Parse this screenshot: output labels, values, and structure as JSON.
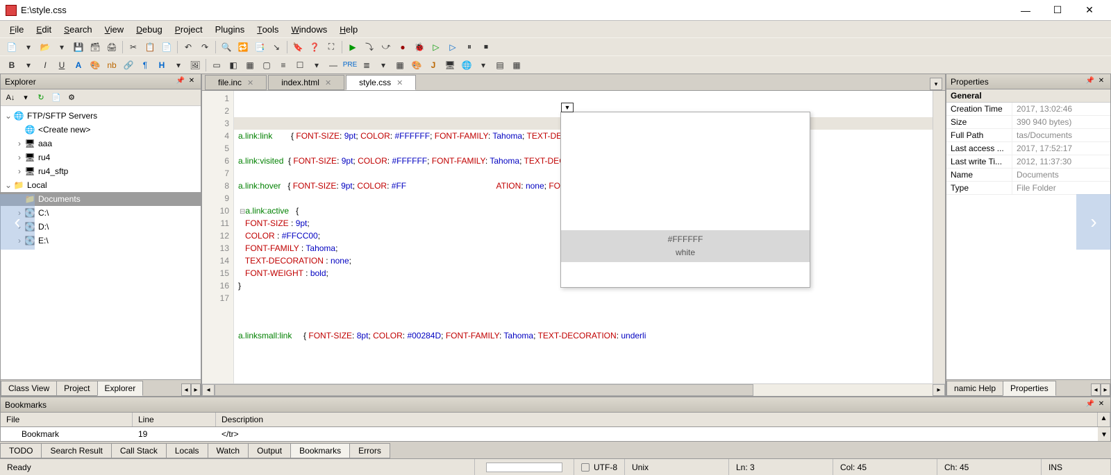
{
  "window": {
    "title": "E:\\style.css"
  },
  "menus": [
    "File",
    "Edit",
    "Search",
    "View",
    "Debug",
    "Project",
    "Plugins",
    "Tools",
    "Windows",
    "Help"
  ],
  "explorer": {
    "title": "Explorer",
    "root_label": "FTP/SFTP Servers",
    "create_new": "<Create new>",
    "items": [
      "aaa",
      "ru4",
      "ru4_sftp"
    ],
    "local_label": "Local",
    "documents": "Documents",
    "drives": [
      "C:\\",
      "D:\\",
      "E:\\"
    ],
    "bottom_tabs": [
      "Class View",
      "Project",
      "Explorer"
    ]
  },
  "file_tabs": [
    "file.inc",
    "index.html",
    "style.css"
  ],
  "active_tab": 2,
  "code_lines": [
    {
      "n": 1,
      "html": "<span class='id'>a.link:link</span>        { <span class='kw'>FONT-SIZE</span>: <span class='val'>9pt</span>; <span class='kw'>COLOR</span>: <span class='val'>#FFFFFF</span>; <span class='kw'>FONT-FAMILY</span>: <span class='val'>Tahoma</span>; <span class='kw'>TEXT-DECORATION</span>: <span class='val'>none</span>; <span class='kw'>F</span>"
    },
    {
      "n": 2,
      "html": ""
    },
    {
      "n": 3,
      "hl": true,
      "html": "<span class='id'>a.link:visited</span>  { <span class='kw'>FONT-SIZE</span>: <span class='val'>9pt</span>; <span class='kw'>COLOR</span>: <span class='val'>#FFFFFF</span>; <span class='kw'>FONT-FAMILY</span>: <span class='val'>Tahoma</span>; <span class='kw'>TEXT-DECORATION</span>: <span class='val'>none</span>; <span class='kw'>FONT-</span>"
    },
    {
      "n": 4,
      "html": ""
    },
    {
      "n": 5,
      "html": "<span class='id'>a.link:hover</span>   { <span class='kw'>FONT-SIZE</span>: <span class='val'>9pt</span>; <span class='kw'>COLOR</span>: <span class='val'>#FF</span>                                       <span class='kw' style='margin-left:0'>ATION</span>: <span class='val'>none</span>; <span class='kw'>FONT-</span>"
    },
    {
      "n": 6,
      "html": ""
    },
    {
      "n": 7,
      "html": "<span class='fold'>⊟</span><span class='id'>a.link:active</span>   {"
    },
    {
      "n": 8,
      "html": "   <span class='kw'>FONT-SIZE</span> : <span class='val'>9pt</span>;"
    },
    {
      "n": 9,
      "html": "   <span class='kw'>COLOR</span> : <span class='val'>#FFCC00</span>;"
    },
    {
      "n": 10,
      "html": "   <span class='kw'>FONT-FAMILY</span> : <span class='val'>Tahoma</span>;"
    },
    {
      "n": 11,
      "html": "   <span class='kw'>TEXT-DECORATION</span> : <span class='val'>none</span>;"
    },
    {
      "n": 12,
      "html": "   <span class='kw'>FONT-WEIGHT</span> : <span class='val'>bold</span>;"
    },
    {
      "n": 13,
      "html": "}"
    },
    {
      "n": 14,
      "html": ""
    },
    {
      "n": 15,
      "html": ""
    },
    {
      "n": 16,
      "html": ""
    },
    {
      "n": 17,
      "html": "<span class='id'>a.linksmall:link</span>     { <span class='kw'>FONT-SIZE</span>: <span class='val'>8pt</span>; <span class='kw'>COLOR</span>: <span class='val'>#00284D</span>; <span class='kw'>FONT-FAMILY</span>: <span class='val'>Tahoma</span>; <span class='kw'>TEXT-DECORATION</span>: <span class='val'>underli</span>"
    }
  ],
  "color_popup": {
    "hex": "#FFFFFF",
    "name": "white"
  },
  "properties": {
    "title": "Properties",
    "section": "General",
    "rows": [
      {
        "k": "Creation Time",
        "v": "2017, 13:02:46"
      },
      {
        "k": "Size",
        "v": "390 940 bytes)"
      },
      {
        "k": "Full Path",
        "v": "tas/Documents"
      },
      {
        "k": "Last access ...",
        "v": "2017, 17:52:17"
      },
      {
        "k": "Last write Ti...",
        "v": "2012, 11:37:30"
      },
      {
        "k": "Name",
        "v": "Documents"
      },
      {
        "k": "Type",
        "v": "File Folder"
      }
    ],
    "bottom_tabs": [
      "namic Help",
      "Properties"
    ]
  },
  "bookmarks": {
    "title": "Bookmarks",
    "cols": [
      "File",
      "Line",
      "Description"
    ],
    "row": {
      "file": "Bookmark",
      "line": "19",
      "desc": "</tr>"
    }
  },
  "bottom_panel_tabs": [
    "TODO",
    "Search Result",
    "Call Stack",
    "Locals",
    "Watch",
    "Output",
    "Bookmarks",
    "Errors"
  ],
  "active_bottom_tab": 6,
  "status": {
    "ready": "Ready",
    "encoding": "UTF-8",
    "eol": "Unix",
    "ln": "Ln: 3",
    "col": "Col: 45",
    "ch": "Ch: 45",
    "ins": "INS"
  }
}
